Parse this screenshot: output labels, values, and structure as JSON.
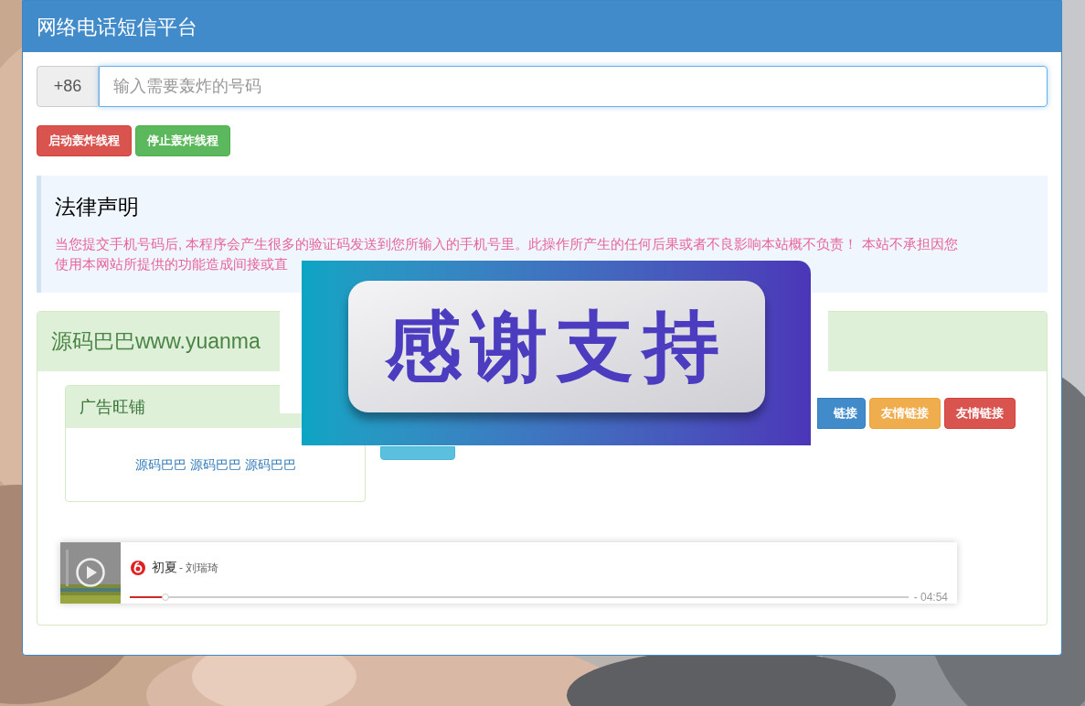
{
  "header": {
    "title": "网络电话短信平台"
  },
  "phone_input": {
    "prefix": "+86",
    "placeholder": "输入需要轰炸的号码"
  },
  "buttons": [
    {
      "label": "启动轰炸线程",
      "kind": "danger"
    },
    {
      "label": "停止轰炸线程",
      "kind": "success"
    }
  ],
  "notice": {
    "title": "法律声明",
    "lines": [
      "当您提交手机号码后, 本程序会产生很多的验证码发送到您所输入的手机号里。此操作所产生的任何后果或者不良影响本站概不负责！ 本站不承担因您",
      "使用本网站所提供的功能造成间接或直"
    ]
  },
  "section": {
    "title": "源码巴巴www.yuanma",
    "ad_panel": {
      "title": "广告旺铺",
      "links": [
        "源码巴巴",
        "源码巴巴",
        "源码巴巴"
      ]
    },
    "link_buttons": [
      {
        "label": "链接",
        "kind": "primary"
      },
      {
        "label": "友情链接",
        "kind": "warning"
      },
      {
        "label": "友情链接",
        "kind": "danger"
      },
      {
        "kind": "info"
      }
    ]
  },
  "banner": {
    "text": "感谢支持"
  },
  "player": {
    "title": "初夏",
    "artist": "- 刘瑞琦",
    "level": 0.046,
    "time": "- 04:54"
  }
}
